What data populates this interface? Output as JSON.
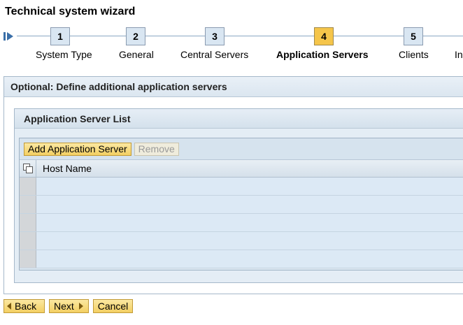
{
  "wizard": {
    "title": "Technical system wizard"
  },
  "roadmap": {
    "start_icon": "roadmap-start-icon",
    "steps": [
      {
        "number": "1",
        "label": "System Type",
        "active": false
      },
      {
        "number": "2",
        "label": "General",
        "active": false
      },
      {
        "number": "3",
        "label": "Central Servers",
        "active": false
      },
      {
        "number": "4",
        "label": "Application Servers",
        "active": true
      },
      {
        "number": "5",
        "label": "Clients",
        "active": false
      },
      {
        "label": "In"
      }
    ]
  },
  "main": {
    "header": "Optional: Define additional application servers",
    "list": {
      "header": "Application Server List",
      "toolbar": {
        "add_label": "Add Application Server",
        "remove_label": "Remove",
        "remove_disabled": true
      },
      "columns": [
        "Host Name"
      ],
      "select_all_icon": "select-all-icon",
      "rows": [
        {
          "host": ""
        },
        {
          "host": ""
        },
        {
          "host": ""
        },
        {
          "host": ""
        },
        {
          "host": ""
        }
      ]
    }
  },
  "footer": {
    "back_label": "Back",
    "next_label": "Next",
    "cancel_label": "Cancel"
  },
  "colors": {
    "accent_button": "#f3cf62",
    "active_step": "#f5c54a",
    "panel_header": "#dbe6f0"
  }
}
